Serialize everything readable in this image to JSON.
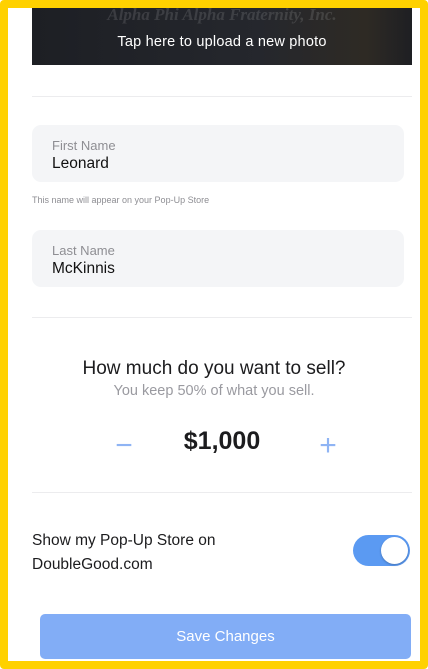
{
  "photo": {
    "watermark": "Alpha Phi Alpha Fraternity, Inc.",
    "upload_label": "Tap here to upload a new photo"
  },
  "first_name": {
    "label": "First Name",
    "value": "Leonard",
    "hint": "This name will appear on your Pop-Up Store"
  },
  "last_name": {
    "label": "Last Name",
    "value": "McKinnis"
  },
  "sell": {
    "title": "How much do you want to sell?",
    "subtitle": "You keep 50% of what you sell.",
    "amount": "$1,000",
    "minus_symbol": "−",
    "plus_symbol": "+"
  },
  "store_toggle": {
    "label": "Show my Pop-Up Store on DoubleGood.com",
    "enabled": true
  },
  "save_button": {
    "label": "Save Changes"
  },
  "colors": {
    "frame_border": "#FFD100",
    "accent": "#5B9AF2",
    "button": "#82ADF6"
  }
}
